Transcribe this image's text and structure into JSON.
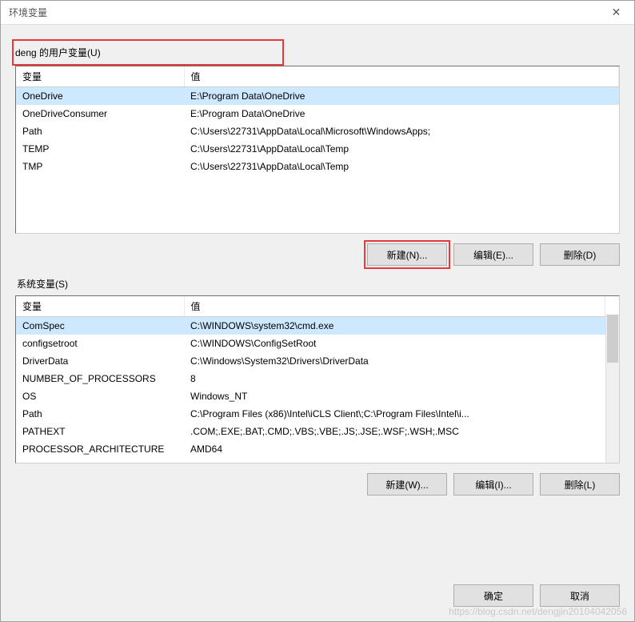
{
  "window": {
    "title": "环境变量"
  },
  "user_section": {
    "label": "deng 的用户变量(U)",
    "headers": {
      "var": "变量",
      "val": "值"
    },
    "rows": [
      {
        "var": "OneDrive",
        "val": "E:\\Program Data\\OneDrive"
      },
      {
        "var": "OneDriveConsumer",
        "val": "E:\\Program Data\\OneDrive"
      },
      {
        "var": "Path",
        "val": "C:\\Users\\22731\\AppData\\Local\\Microsoft\\WindowsApps;"
      },
      {
        "var": "TEMP",
        "val": "C:\\Users\\22731\\AppData\\Local\\Temp"
      },
      {
        "var": "TMP",
        "val": "C:\\Users\\22731\\AppData\\Local\\Temp"
      }
    ],
    "buttons": {
      "new": "新建(N)...",
      "edit": "编辑(E)...",
      "delete": "删除(D)"
    }
  },
  "system_section": {
    "label": "系统变量(S)",
    "headers": {
      "var": "变量",
      "val": "值"
    },
    "rows": [
      {
        "var": "ComSpec",
        "val": "C:\\WINDOWS\\system32\\cmd.exe"
      },
      {
        "var": "configsetroot",
        "val": "C:\\WINDOWS\\ConfigSetRoot"
      },
      {
        "var": "DriverData",
        "val": "C:\\Windows\\System32\\Drivers\\DriverData"
      },
      {
        "var": "NUMBER_OF_PROCESSORS",
        "val": "8"
      },
      {
        "var": "OS",
        "val": "Windows_NT"
      },
      {
        "var": "Path",
        "val": "C:\\Program Files (x86)\\Intel\\iCLS Client\\;C:\\Program Files\\Intel\\i..."
      },
      {
        "var": "PATHEXT",
        "val": ".COM;.EXE;.BAT;.CMD;.VBS;.VBE;.JS;.JSE;.WSF;.WSH;.MSC"
      },
      {
        "var": "PROCESSOR_ARCHITECTURE",
        "val": "AMD64"
      }
    ],
    "buttons": {
      "new": "新建(W)...",
      "edit": "编辑(I)...",
      "delete": "删除(L)"
    }
  },
  "dialog_buttons": {
    "ok": "确定",
    "cancel": "取消"
  },
  "watermark": "https://blog.csdn.net/dengjin20104042056"
}
